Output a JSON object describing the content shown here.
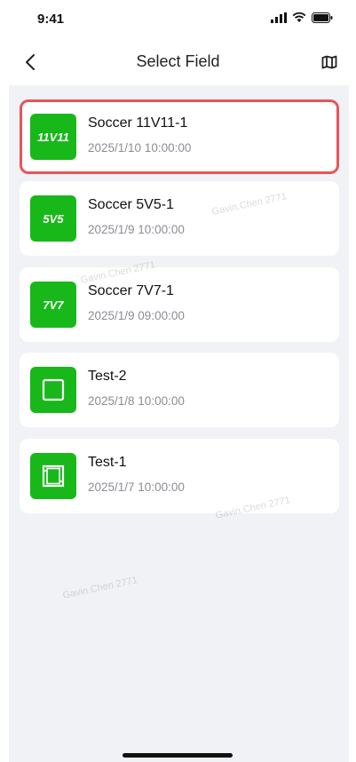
{
  "status": {
    "time": "9:41"
  },
  "header": {
    "title": "Select Field"
  },
  "fields": [
    {
      "icon_label": "11V11",
      "title": "Soccer 11V11-1",
      "date": "2025/1/10 10:00:00"
    },
    {
      "icon_label": "5V5",
      "title": "Soccer 5V5-1",
      "date": "2025/1/9 10:00:00"
    },
    {
      "icon_label": "7V7",
      "title": "Soccer 7V7-1",
      "date": "2025/1/9 09:00:00"
    },
    {
      "icon_label": "",
      "title": "Test-2",
      "date": "2025/1/8 10:00:00"
    },
    {
      "icon_label": "",
      "title": "Test-1",
      "date": "2025/1/7 10:00:00"
    }
  ],
  "watermark": "Gavin.Chen 2771",
  "colors": {
    "accent": "#18b81a",
    "selection": "#e8545a",
    "background": "#f1f2f5"
  }
}
